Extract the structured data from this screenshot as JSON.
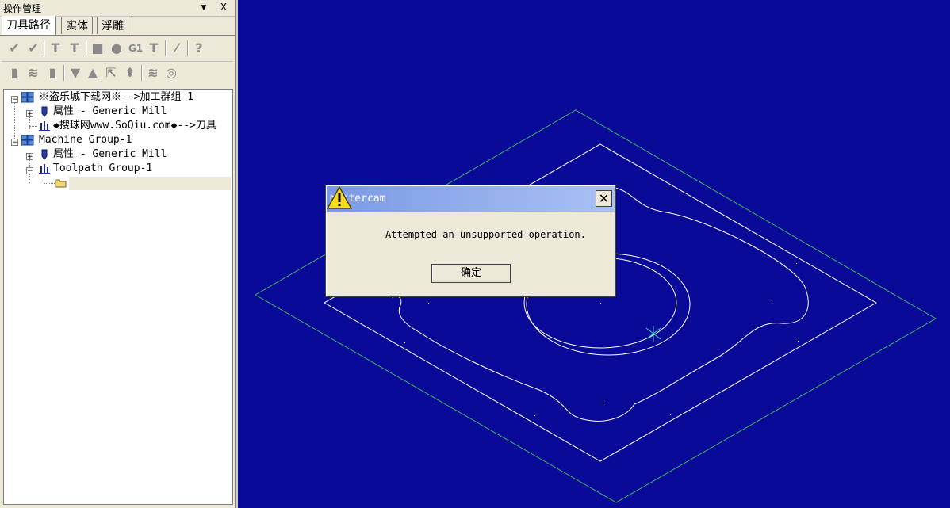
{
  "panel": {
    "title": "操作管理",
    "close_label": "X",
    "dropdown_glyph": "▼",
    "tabs": [
      {
        "label": "刀具路径"
      },
      {
        "label": "实体"
      },
      {
        "label": "浮雕"
      }
    ]
  },
  "tree": {
    "nodes": [
      {
        "label": "※盗乐城下载网※-->加工群组 1"
      },
      {
        "label": "属性 - Generic Mill"
      },
      {
        "label": "◆搜球网www.SoQiu.com◆-->刀具"
      },
      {
        "label": "Machine Group-1"
      },
      {
        "label": "属性 - Generic Mill"
      },
      {
        "label": "Toolpath Group-1"
      }
    ]
  },
  "toolbar": {
    "row1_icons": [
      "check-all-icon",
      "check-clear-icon",
      "tool-select-icon",
      "tool-clear-icon",
      "regen-icon",
      "regen-dirty-icon",
      "g1-backplot-icon",
      "post-icon",
      "wand-icon",
      "help-icon"
    ],
    "g1_label": "G1",
    "row2_icons": [
      "lock-icon",
      "wave-icon",
      "folder-lock-icon",
      "down-arrow-icon",
      "up-arrow-icon",
      "insert-arrow-icon",
      "updown-icon",
      "wave-off-icon",
      "target-icon"
    ]
  },
  "dialog": {
    "title": "mastercam",
    "close_glyph": "✕",
    "message": "Attempted an unsupported operation.",
    "ok_label": "确定"
  },
  "colors": {
    "canvas_bg": "#0a0a98",
    "stock_outline": "#3cb464",
    "geometry": "#ffffff"
  }
}
